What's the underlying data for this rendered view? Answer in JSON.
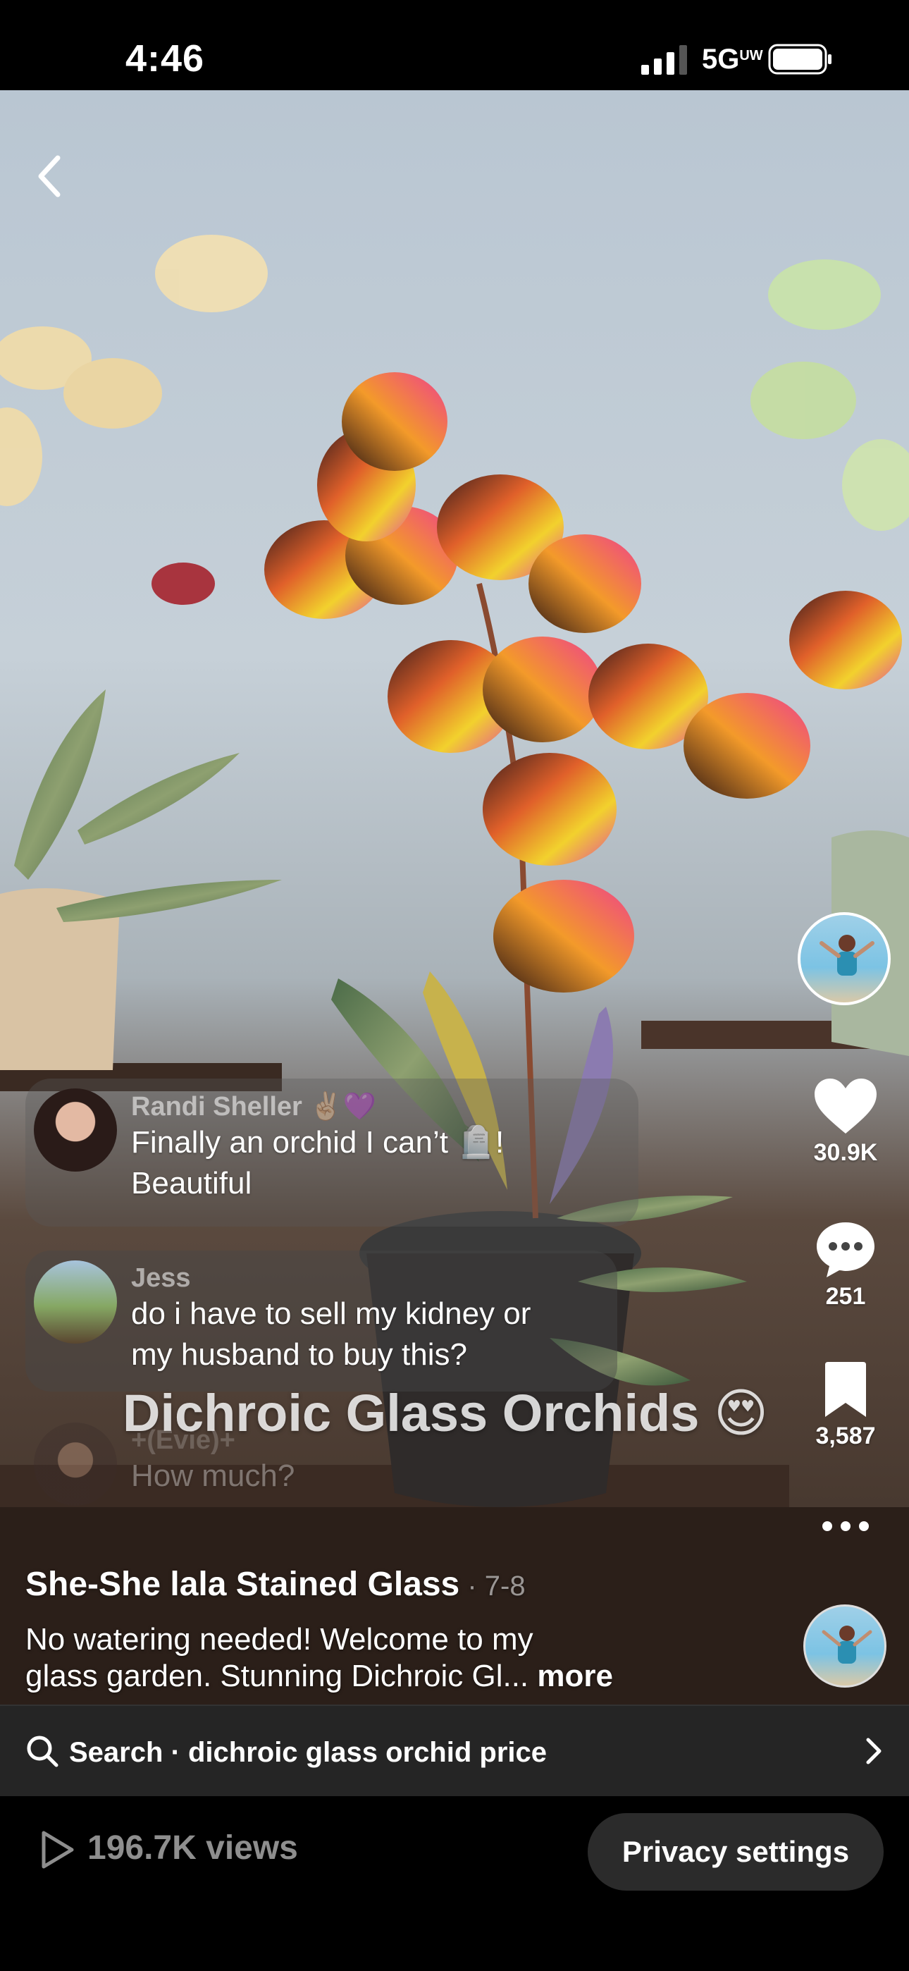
{
  "status_bar": {
    "time": "4:46",
    "network": "5G",
    "network_sub": "UW"
  },
  "comments": [
    {
      "user": "Randi Sheller ✌🏼💜",
      "text_line1": "Finally an orchid I can’t 🪦!",
      "text_line2": "Beautiful"
    },
    {
      "user": "Jess",
      "text_line1": "do i have to sell my kidney or",
      "text_line2": "my husband to buy this?"
    },
    {
      "user": "+(Evie)+",
      "text_line1": "How much?"
    }
  ],
  "video_caption": "Dichroic Glass Orchids 😍",
  "actions": {
    "likes": "30.9K",
    "comments": "251",
    "saves": "3,587"
  },
  "post": {
    "author": "She-She lala Stained Glass",
    "date": " · 7-8",
    "description_line1": "No watering needed! Welcome to my",
    "description_line2": "glass garden. Stunning Dichroic Gl... ",
    "more_label": "more"
  },
  "search": {
    "label": "Search · dichroic glass orchid price"
  },
  "footer": {
    "views": "196.7K views",
    "privacy_button": "Privacy settings"
  },
  "colors": {
    "bar_bg": "#252525",
    "muted_text": "#8e8e8e",
    "accent": "#ffffff"
  },
  "icons": [
    "back-icon",
    "heart-icon",
    "comment-icon",
    "bookmark-icon",
    "more-icon",
    "search-icon",
    "chevron-right-icon",
    "play-icon"
  ]
}
